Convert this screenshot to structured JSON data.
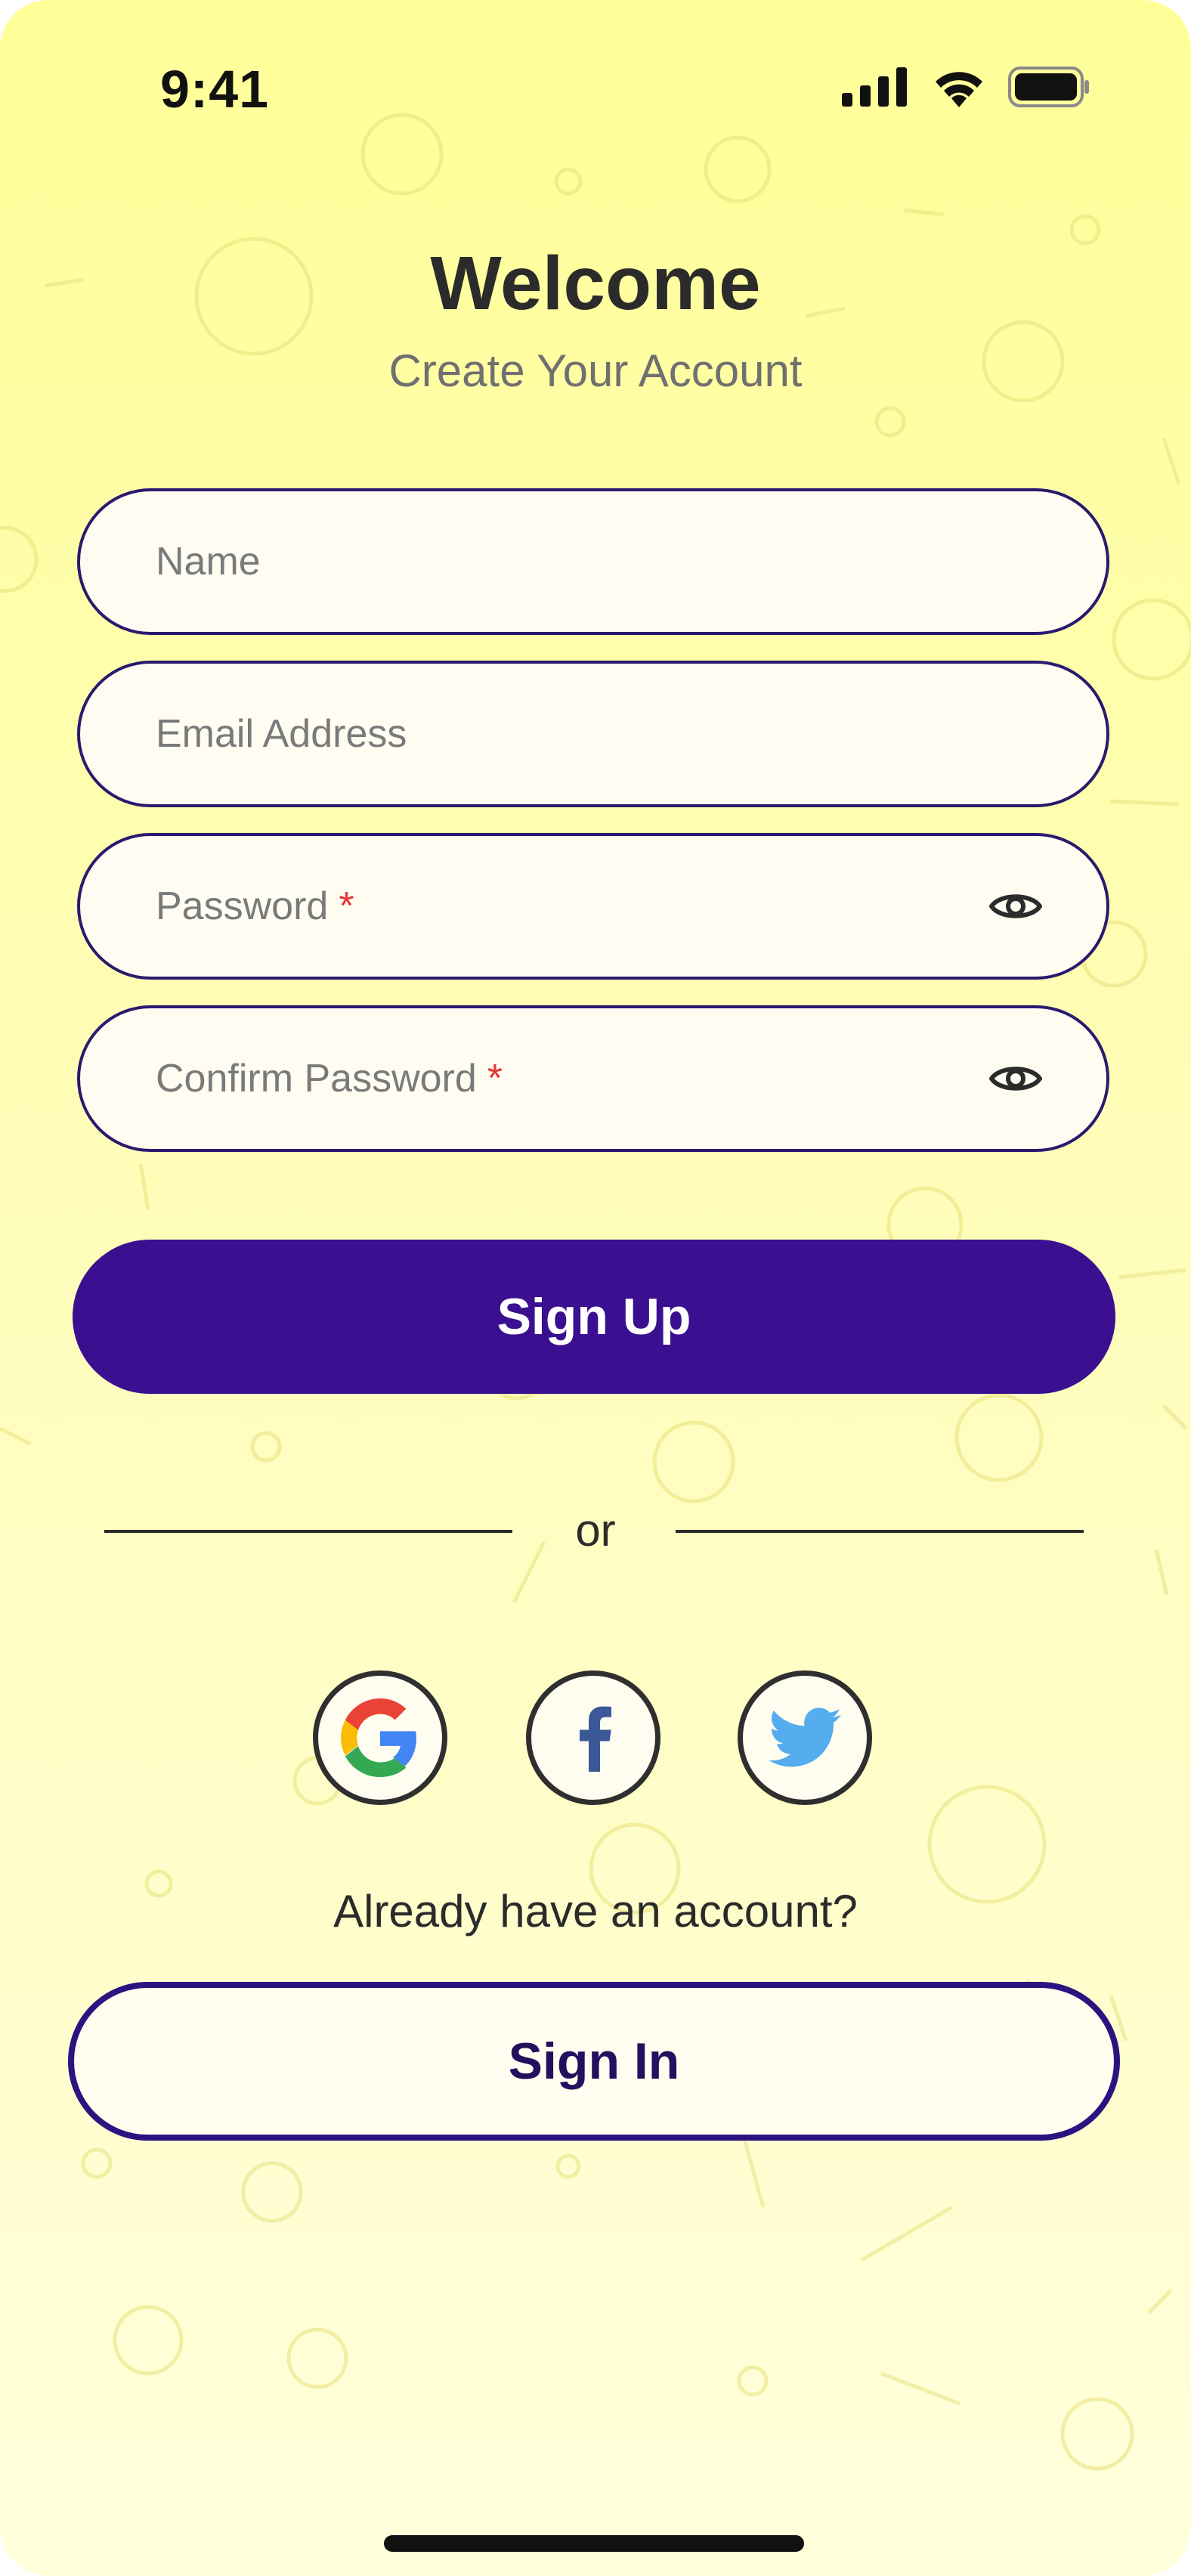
{
  "status_bar": {
    "time": "9:41"
  },
  "header": {
    "title": "Welcome",
    "subtitle": "Create Your Account"
  },
  "form": {
    "name_placeholder": "Name",
    "email_placeholder": "Email Address",
    "password_label": "Password",
    "confirm_password_label": "Confirm Password",
    "required_marker": "*"
  },
  "actions": {
    "sign_up_label": "Sign Up",
    "divider_text": "or",
    "already_have_account": "Already have an account?",
    "sign_in_label": "Sign In"
  },
  "social": [
    {
      "name": "google",
      "icon": "google-icon"
    },
    {
      "name": "facebook",
      "icon": "facebook-icon"
    },
    {
      "name": "twitter",
      "icon": "twitter-icon"
    }
  ],
  "colors": {
    "background_top": "#ffff99",
    "background_bottom": "#ffffdc",
    "primary": "#3a1090",
    "field_border": "#2a1a6e",
    "required": "#e53935",
    "google_blue": "#4285f4",
    "google_red": "#ea4335",
    "google_yellow": "#fbbc05",
    "google_green": "#34a853",
    "facebook_blue": "#3b5998",
    "twitter_blue": "#55acee"
  }
}
